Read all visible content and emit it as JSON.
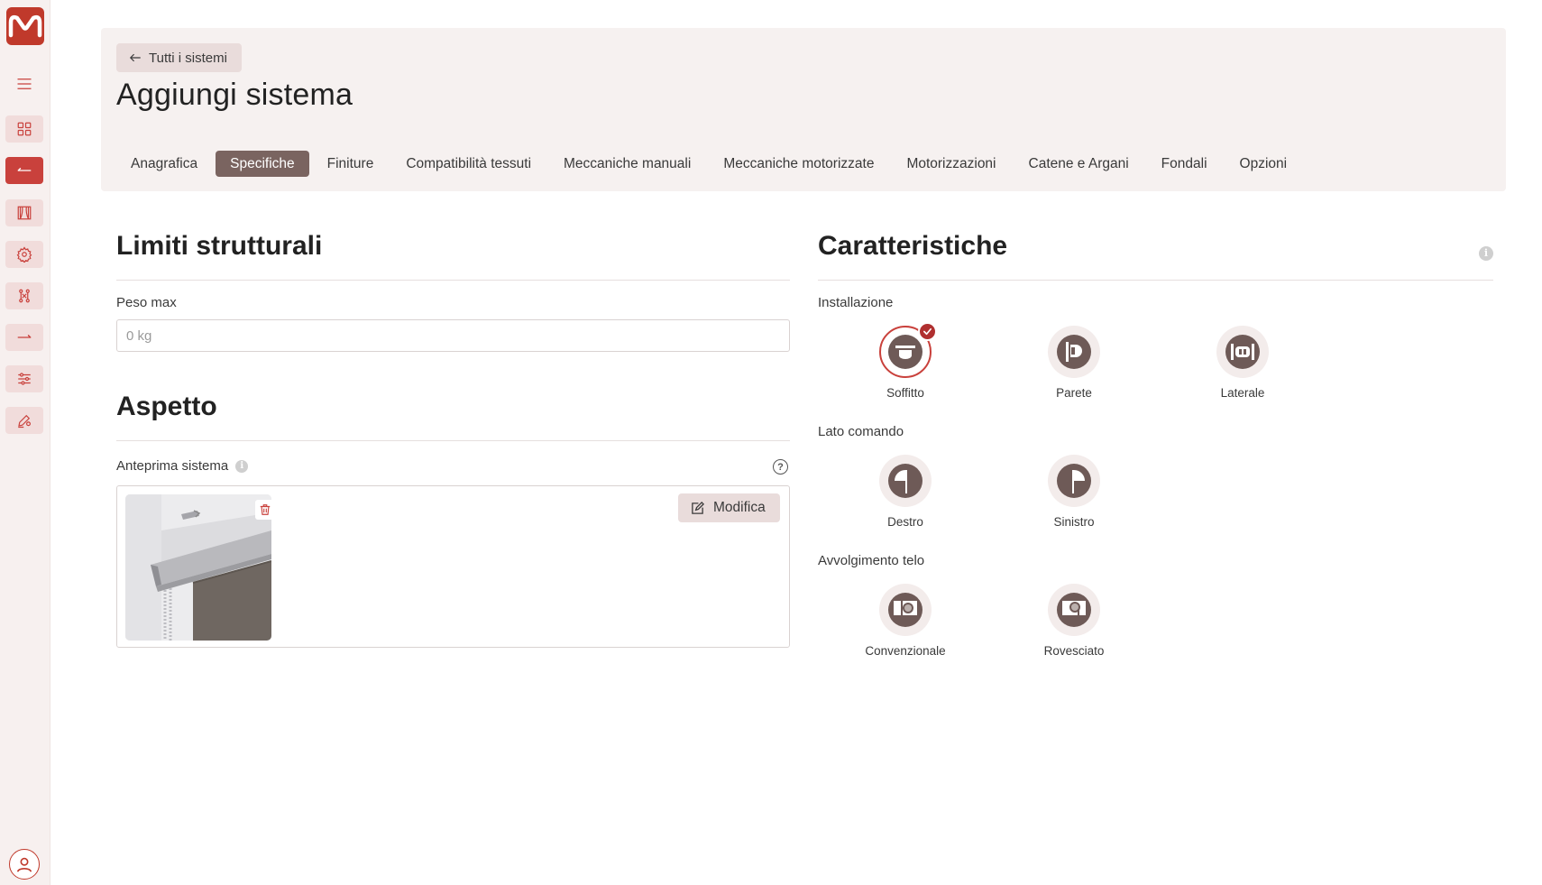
{
  "header": {
    "back_label": "Tutti i sistemi",
    "title": "Aggiungi sistema"
  },
  "tabs": [
    {
      "label": "Anagrafica",
      "active": false
    },
    {
      "label": "Specifiche",
      "active": true
    },
    {
      "label": "Finiture",
      "active": false
    },
    {
      "label": "Compatibilità tessuti",
      "active": false
    },
    {
      "label": "Meccaniche manuali",
      "active": false
    },
    {
      "label": "Meccaniche motorizzate",
      "active": false
    },
    {
      "label": "Motorizzazioni",
      "active": false
    },
    {
      "label": "Catene e Argani",
      "active": false
    },
    {
      "label": "Fondali",
      "active": false
    },
    {
      "label": "Opzioni",
      "active": false
    }
  ],
  "limits": {
    "title": "Limiti strutturali",
    "weight_label": "Peso max",
    "weight_placeholder": "0 kg",
    "weight_value": ""
  },
  "appearance": {
    "title": "Aspetto",
    "preview_label": "Anteprima sistema",
    "edit_label": "Modifica"
  },
  "features": {
    "title": "Caratteristiche",
    "installation": {
      "label": "Installazione",
      "options": [
        {
          "label": "Soffitto",
          "icon": "ceiling-mount-icon",
          "selected": true
        },
        {
          "label": "Parete",
          "icon": "wall-mount-icon",
          "selected": false
        },
        {
          "label": "Laterale",
          "icon": "side-mount-icon",
          "selected": false
        }
      ]
    },
    "control_side": {
      "label": "Lato comando",
      "options": [
        {
          "label": "Destro",
          "icon": "right-control-icon",
          "selected": false
        },
        {
          "label": "Sinistro",
          "icon": "left-control-icon",
          "selected": false
        }
      ]
    },
    "winding": {
      "label": "Avvolgimento telo",
      "options": [
        {
          "label": "Convenzionale",
          "icon": "conventional-winding-icon",
          "selected": false
        },
        {
          "label": "Rovesciato",
          "icon": "reverse-winding-icon",
          "selected": false
        }
      ]
    }
  },
  "colors": {
    "accent": "#c9413c",
    "brand": "#c0392b",
    "active_tab": "#7a6460",
    "option_icon": "#6e5a57"
  }
}
